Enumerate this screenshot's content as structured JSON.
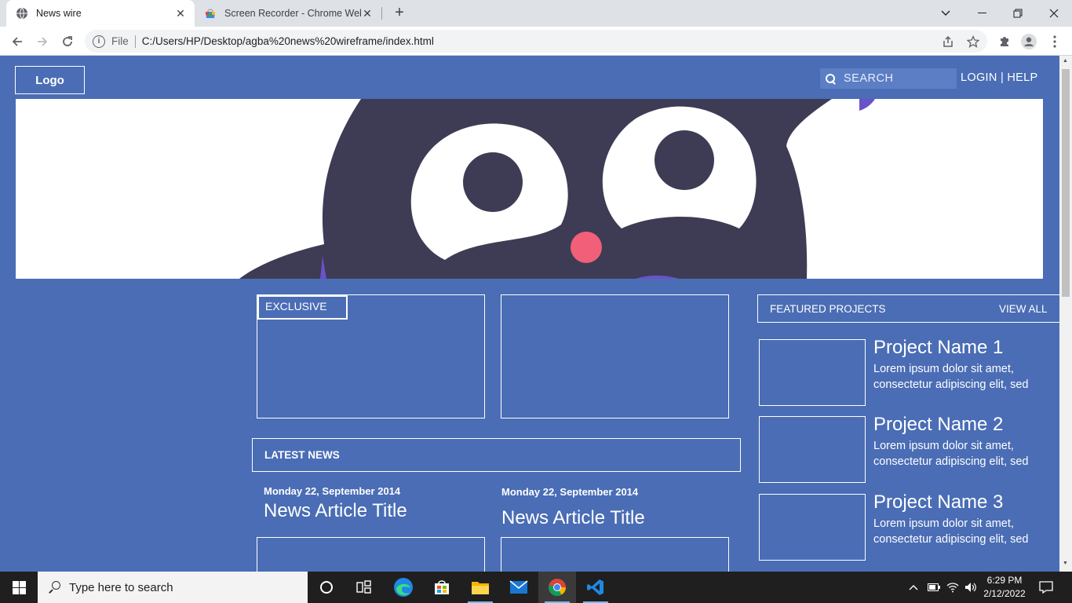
{
  "browser": {
    "tabs": [
      {
        "title": "News wire",
        "icon": "globe-icon"
      },
      {
        "title": "Screen Recorder - Chrome Web S",
        "icon": "chrome-web-store-icon"
      }
    ],
    "address": {
      "scheme_label": "File",
      "url": "C:/Users/HP/Desktop/agba%20news%20wireframe/index.html"
    }
  },
  "page": {
    "logo": "Logo",
    "search_placeholder": "SEARCH",
    "login_help": "LOGIN | HELP",
    "exclusive_label": "EXCLUSIVE",
    "latest_news_label": "LATEST NEWS",
    "featured": {
      "label": "FEATURED PROJECTS",
      "view_all": "VIEW ALL"
    },
    "articles": [
      {
        "date": "Monday 22, September 2014",
        "title": "News Article Title"
      },
      {
        "date": "Monday 22, September 2014",
        "title": "News Article Title"
      }
    ],
    "projects": [
      {
        "name": "Project Name 1",
        "desc": "Lorem ipsum dolor sit amet, consectetur adipiscing elit, sed"
      },
      {
        "name": "Project Name 2",
        "desc": "Lorem ipsum dolor sit amet, consectetur adipiscing elit, sed"
      },
      {
        "name": "Project Name 3",
        "desc": "Lorem ipsum dolor sit amet, consectetur adipiscing elit, sed"
      }
    ],
    "colors": {
      "background": "#4a6db5",
      "text": "#ffffff",
      "mascot": "#3e3b55",
      "nose": "#f25f78"
    }
  },
  "taskbar": {
    "search_placeholder": "Type here to search",
    "time": "6:29 PM",
    "date": "2/12/2022"
  }
}
